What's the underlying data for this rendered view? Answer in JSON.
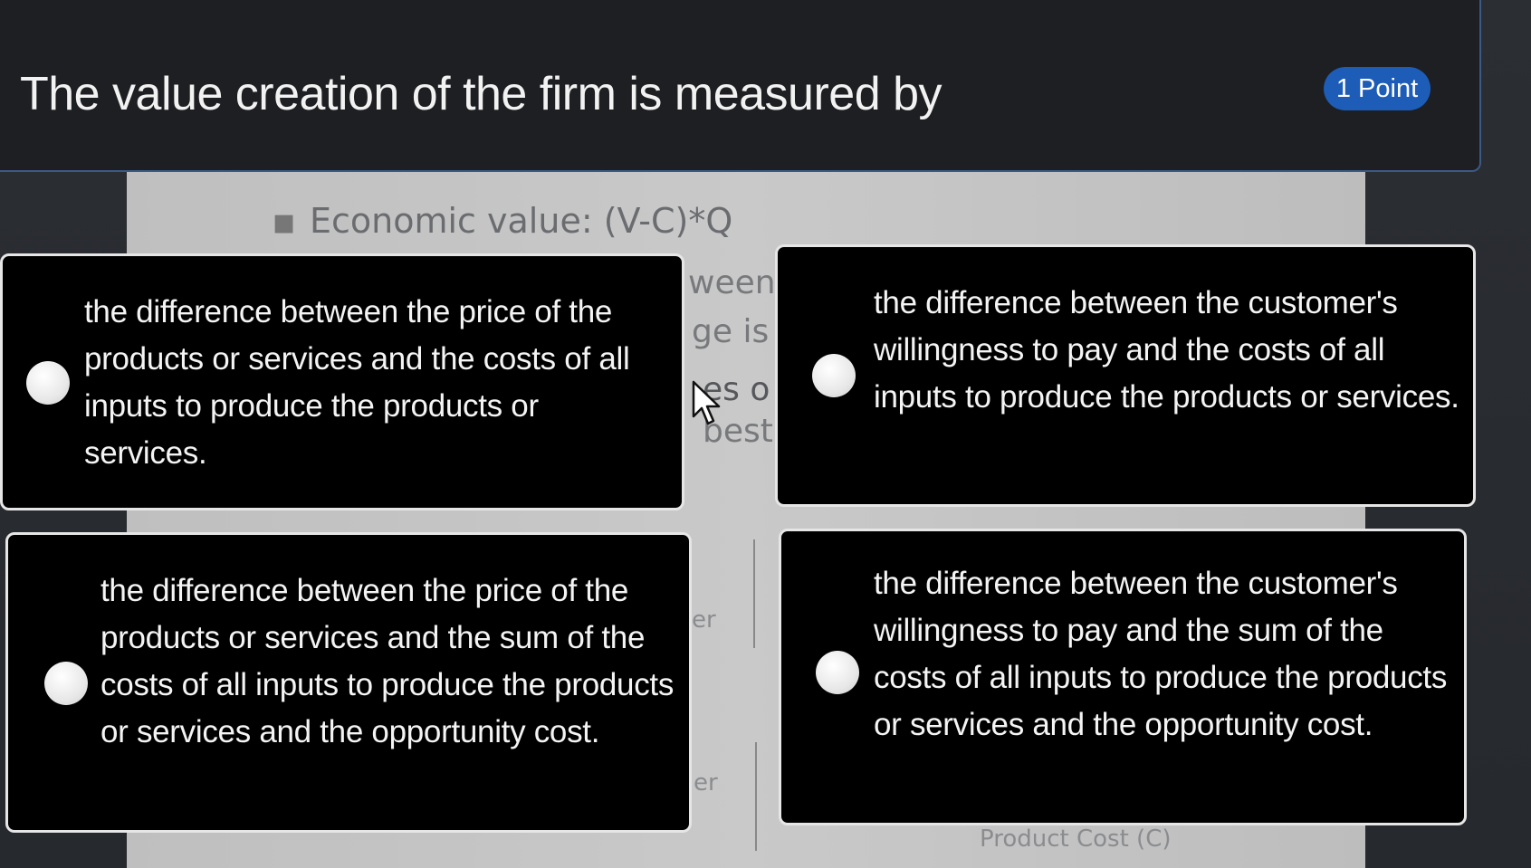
{
  "question": {
    "text": "The value creation of the firm is measured by",
    "points": "1 Point"
  },
  "background_slide": {
    "bullet": "▪",
    "formula": "Economic value: (V-C)*Q",
    "fragments": [
      "ween",
      "ge is",
      "es o",
      "best",
      "er",
      "er",
      "Product Cost (C)"
    ]
  },
  "options": [
    {
      "id": "a",
      "text": "the difference between the price of the products or services and the costs of all inputs to produce the products or services."
    },
    {
      "id": "b",
      "text": "the difference between the customer's willingness to pay and the costs of all inputs to produce the products or services."
    },
    {
      "id": "c",
      "text": "the difference between the price of the products or services and the sum of the costs of all inputs to produce the products or services and the opportunity cost."
    },
    {
      "id": "d",
      "text": "the difference between the customer's willingness to pay and the sum of the costs of all inputs to produce the products or services and the opportunity cost."
    }
  ],
  "colors": {
    "accent": "#1d5db8",
    "header_border": "#3c5a86",
    "option_bg": "#000000",
    "option_border": "#e6e6e6"
  }
}
